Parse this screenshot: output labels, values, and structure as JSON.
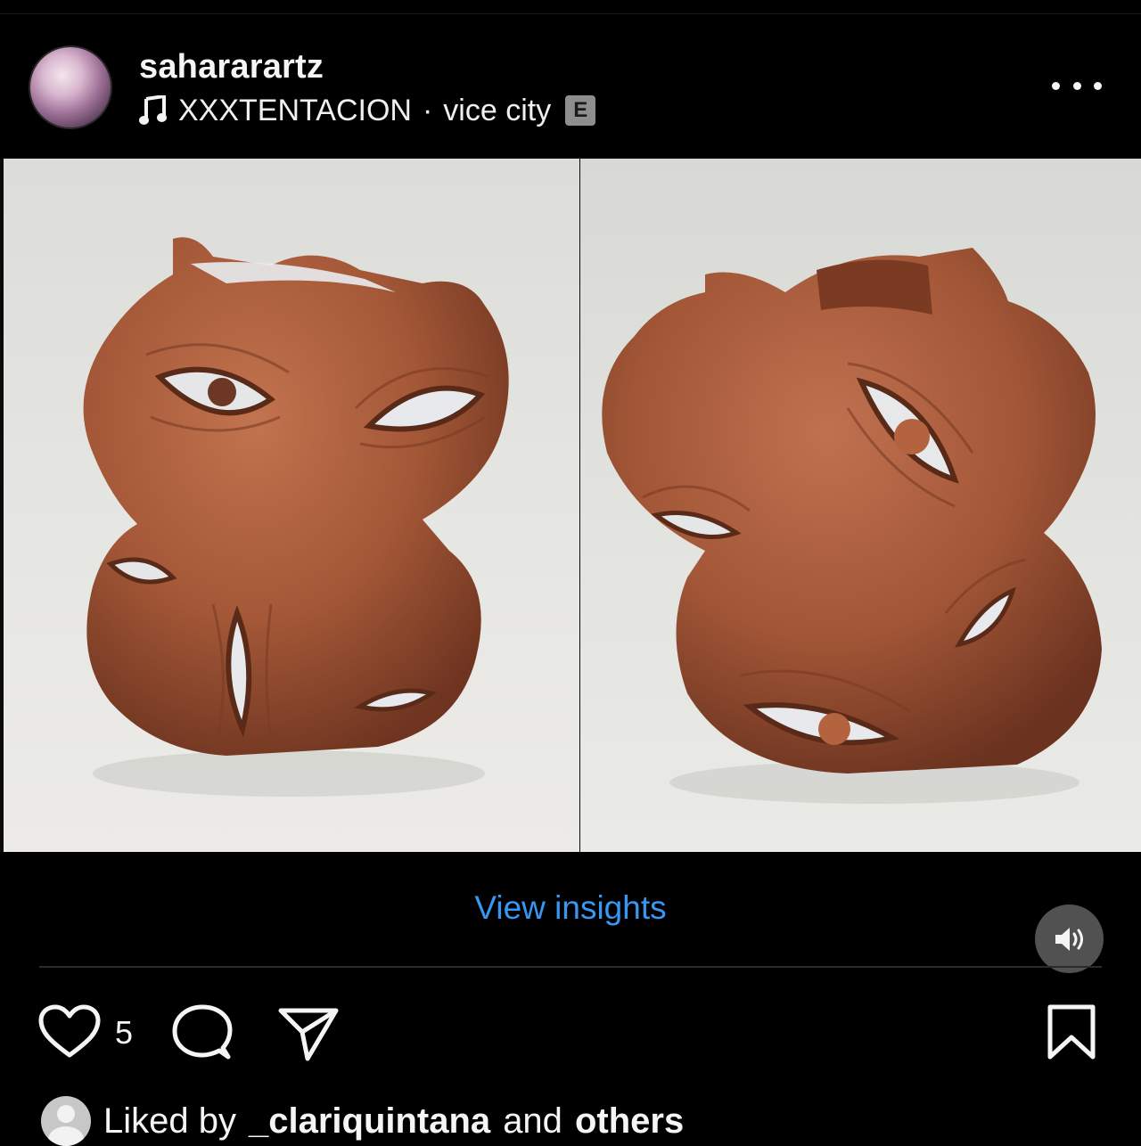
{
  "post": {
    "username": "sahararartz",
    "audio_artist": "XXXTENTACION",
    "audio_separator": "·",
    "audio_track": "vice city",
    "explicit_badge": "E"
  },
  "media": {
    "left_photo_alt": "ceramic multi-eyed vase front view",
    "right_photo_alt": "ceramic multi-eyed vase rotated view",
    "sound_state": "on"
  },
  "insights": {
    "label": "View insights"
  },
  "actions": {
    "like_count": "5"
  },
  "liked_by": {
    "prefix": "Liked by",
    "user": "_clariquintana",
    "conjunction": "and",
    "others": "others"
  },
  "colors": {
    "background": "#000000",
    "text": "#f5f5f5",
    "link": "#3897f0",
    "clay": "#a85a3c",
    "glaze": "#e9ecef"
  },
  "icons": {
    "more": "more-options-icon",
    "music": "music-note-icon",
    "sound": "speaker-icon",
    "like": "heart-icon",
    "comment": "comment-icon",
    "share": "send-icon",
    "save": "bookmark-icon"
  }
}
